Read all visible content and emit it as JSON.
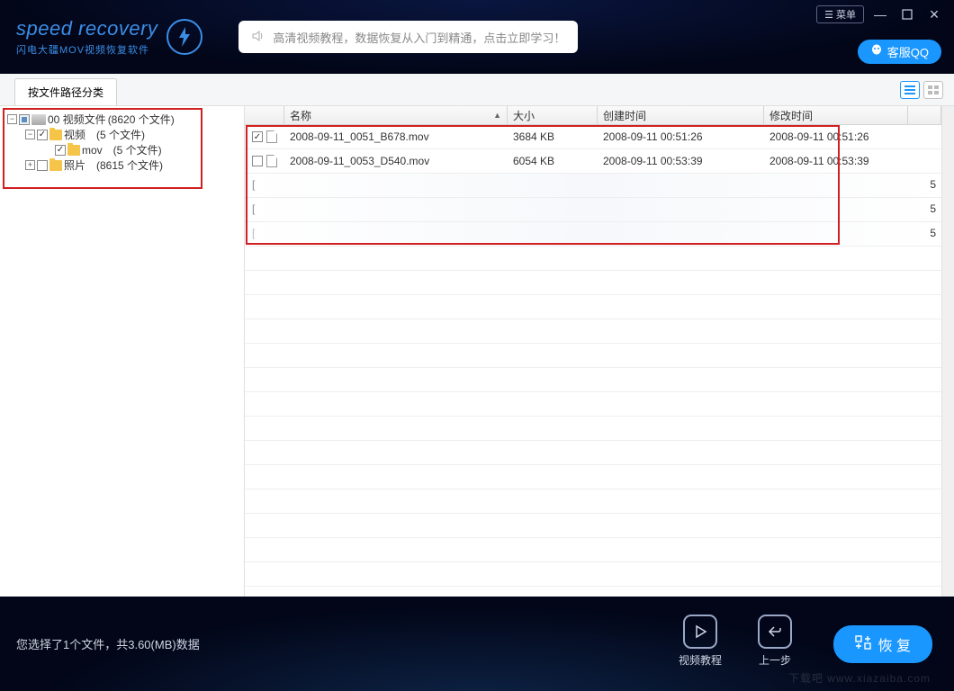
{
  "header": {
    "logo_main": "speed recovery",
    "logo_sub": "闪电大疆MOV视频恢复软件",
    "promo_text": "高清视频教程，数据恢复从入门到精通，点击立即学习！",
    "menu_label": "菜单",
    "qq_label": "客服QQ"
  },
  "subheader": {
    "tab_label": "按文件路径分类"
  },
  "tree": {
    "root": {
      "label": "00 视频文件",
      "count": "(8620 个文件)"
    },
    "node_video": {
      "label": "视频",
      "count": "(5 个文件)"
    },
    "node_mov": {
      "label": "mov",
      "count": "(5 个文件)"
    },
    "node_photo": {
      "label": "照片",
      "count": "(8615 个文件)"
    }
  },
  "columns": {
    "name": "名称",
    "size": "大小",
    "ctime": "创建时间",
    "mtime": "修改时间"
  },
  "rows": [
    {
      "checked": true,
      "name": "2008-09-11_0051_B678.mov",
      "size": "3684 KB",
      "ctime": "2008-09-11  00:51:26",
      "mtime": "2008-09-11  00:51:26"
    },
    {
      "checked": false,
      "name": "2008-09-11_0053_D540.mov",
      "size": "6054 KB",
      "ctime": "2008-09-11  00:53:39",
      "mtime": "2008-09-11  00:53:39"
    }
  ],
  "blurred_tail": "5",
  "footer": {
    "status": "您选择了1个文件，共3.60(MB)数据",
    "video_tutorial": "视频教程",
    "previous": "上一步",
    "recover": "恢 复"
  },
  "watermark": "下载吧 www.xiazaiba.com"
}
